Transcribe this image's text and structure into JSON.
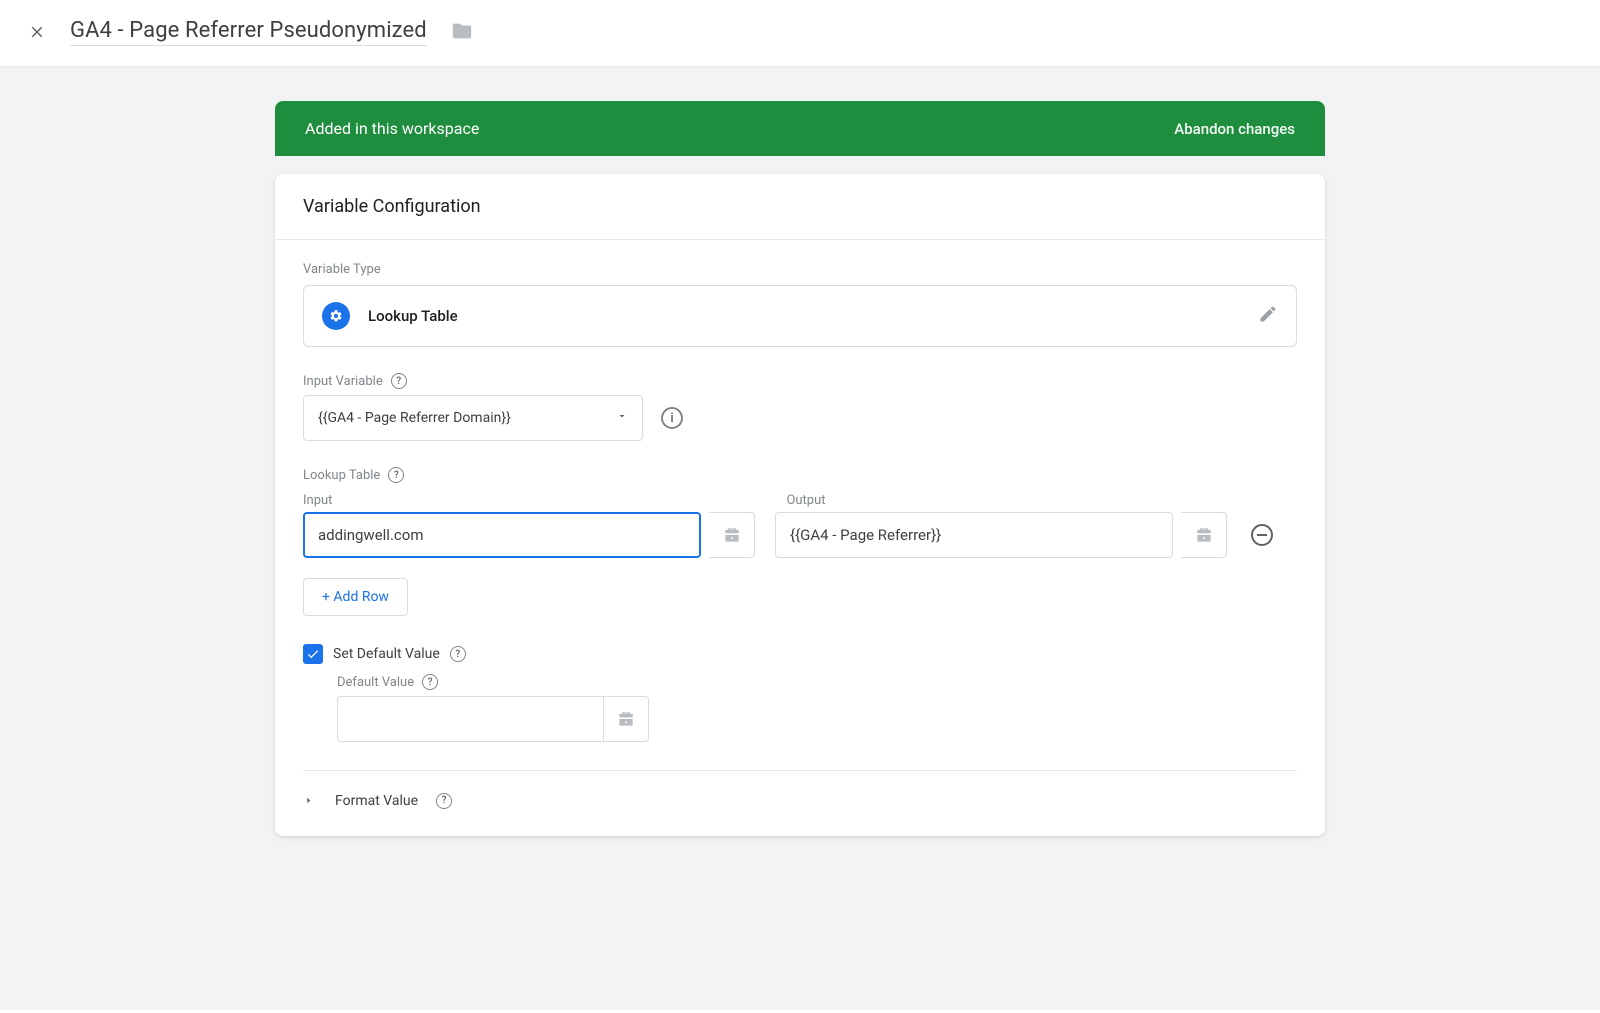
{
  "header": {
    "title": "GA4 - Page Referrer Pseudonymized"
  },
  "status": {
    "message": "Added in this workspace",
    "abandon": "Abandon changes"
  },
  "config": {
    "panel_title": "Variable Configuration",
    "type_label": "Variable Type",
    "type_name": "Lookup Table",
    "input_var_label": "Input Variable",
    "input_var_value": "{{GA4 - Page Referrer Domain}}",
    "lookup_label": "Lookup Table",
    "columns": {
      "input": "Input",
      "output": "Output"
    },
    "rows": [
      {
        "input": "addingwell.com",
        "output": "{{GA4 - Page Referrer}}"
      }
    ],
    "add_row": "+ Add Row",
    "set_default": {
      "checked": true,
      "label": "Set Default Value"
    },
    "default_value_label": "Default Value",
    "default_value": "",
    "format_value": "Format Value"
  }
}
